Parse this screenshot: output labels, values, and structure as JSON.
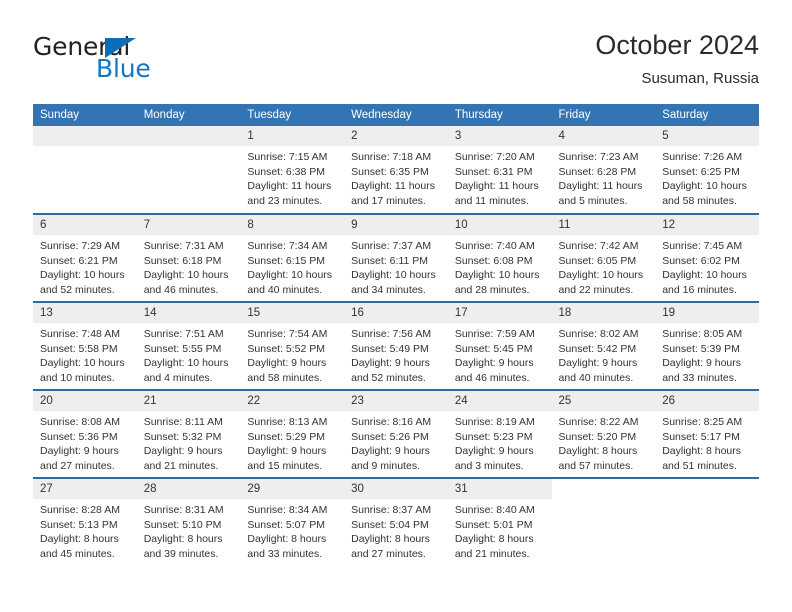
{
  "brand": {
    "name_part1": "General",
    "name_part2": "Blue",
    "triangle_color": "#0f6cb6",
    "blue_color": "#1277c4"
  },
  "header": {
    "title": "October 2024",
    "subtitle": "Susuman, Russia"
  },
  "theme": {
    "header_bg": "#3375b4",
    "week_divider": "#2e6da4",
    "daynum_bg": "#eeeeee",
    "text": "#333333"
  },
  "weekday_headers": [
    "Sunday",
    "Monday",
    "Tuesday",
    "Wednesday",
    "Thursday",
    "Friday",
    "Saturday"
  ],
  "weeks": [
    [
      {
        "day": "",
        "empty": true,
        "blank": false,
        "sunrise": "",
        "sunset": "",
        "daylight1": "",
        "daylight2": ""
      },
      {
        "day": "",
        "empty": true,
        "blank": false,
        "sunrise": "",
        "sunset": "",
        "daylight1": "",
        "daylight2": ""
      },
      {
        "day": "1",
        "sunrise": "Sunrise: 7:15 AM",
        "sunset": "Sunset: 6:38 PM",
        "daylight1": "Daylight: 11 hours",
        "daylight2": "and 23 minutes."
      },
      {
        "day": "2",
        "sunrise": "Sunrise: 7:18 AM",
        "sunset": "Sunset: 6:35 PM",
        "daylight1": "Daylight: 11 hours",
        "daylight2": "and 17 minutes."
      },
      {
        "day": "3",
        "sunrise": "Sunrise: 7:20 AM",
        "sunset": "Sunset: 6:31 PM",
        "daylight1": "Daylight: 11 hours",
        "daylight2": "and 11 minutes."
      },
      {
        "day": "4",
        "sunrise": "Sunrise: 7:23 AM",
        "sunset": "Sunset: 6:28 PM",
        "daylight1": "Daylight: 11 hours",
        "daylight2": "and 5 minutes."
      },
      {
        "day": "5",
        "sunrise": "Sunrise: 7:26 AM",
        "sunset": "Sunset: 6:25 PM",
        "daylight1": "Daylight: 10 hours",
        "daylight2": "and 58 minutes."
      }
    ],
    [
      {
        "day": "6",
        "sunrise": "Sunrise: 7:29 AM",
        "sunset": "Sunset: 6:21 PM",
        "daylight1": "Daylight: 10 hours",
        "daylight2": "and 52 minutes."
      },
      {
        "day": "7",
        "sunrise": "Sunrise: 7:31 AM",
        "sunset": "Sunset: 6:18 PM",
        "daylight1": "Daylight: 10 hours",
        "daylight2": "and 46 minutes."
      },
      {
        "day": "8",
        "sunrise": "Sunrise: 7:34 AM",
        "sunset": "Sunset: 6:15 PM",
        "daylight1": "Daylight: 10 hours",
        "daylight2": "and 40 minutes."
      },
      {
        "day": "9",
        "sunrise": "Sunrise: 7:37 AM",
        "sunset": "Sunset: 6:11 PM",
        "daylight1": "Daylight: 10 hours",
        "daylight2": "and 34 minutes."
      },
      {
        "day": "10",
        "sunrise": "Sunrise: 7:40 AM",
        "sunset": "Sunset: 6:08 PM",
        "daylight1": "Daylight: 10 hours",
        "daylight2": "and 28 minutes."
      },
      {
        "day": "11",
        "sunrise": "Sunrise: 7:42 AM",
        "sunset": "Sunset: 6:05 PM",
        "daylight1": "Daylight: 10 hours",
        "daylight2": "and 22 minutes."
      },
      {
        "day": "12",
        "sunrise": "Sunrise: 7:45 AM",
        "sunset": "Sunset: 6:02 PM",
        "daylight1": "Daylight: 10 hours",
        "daylight2": "and 16 minutes."
      }
    ],
    [
      {
        "day": "13",
        "sunrise": "Sunrise: 7:48 AM",
        "sunset": "Sunset: 5:58 PM",
        "daylight1": "Daylight: 10 hours",
        "daylight2": "and 10 minutes."
      },
      {
        "day": "14",
        "sunrise": "Sunrise: 7:51 AM",
        "sunset": "Sunset: 5:55 PM",
        "daylight1": "Daylight: 10 hours",
        "daylight2": "and 4 minutes."
      },
      {
        "day": "15",
        "sunrise": "Sunrise: 7:54 AM",
        "sunset": "Sunset: 5:52 PM",
        "daylight1": "Daylight: 9 hours",
        "daylight2": "and 58 minutes."
      },
      {
        "day": "16",
        "sunrise": "Sunrise: 7:56 AM",
        "sunset": "Sunset: 5:49 PM",
        "daylight1": "Daylight: 9 hours",
        "daylight2": "and 52 minutes."
      },
      {
        "day": "17",
        "sunrise": "Sunrise: 7:59 AM",
        "sunset": "Sunset: 5:45 PM",
        "daylight1": "Daylight: 9 hours",
        "daylight2": "and 46 minutes."
      },
      {
        "day": "18",
        "sunrise": "Sunrise: 8:02 AM",
        "sunset": "Sunset: 5:42 PM",
        "daylight1": "Daylight: 9 hours",
        "daylight2": "and 40 minutes."
      },
      {
        "day": "19",
        "sunrise": "Sunrise: 8:05 AM",
        "sunset": "Sunset: 5:39 PM",
        "daylight1": "Daylight: 9 hours",
        "daylight2": "and 33 minutes."
      }
    ],
    [
      {
        "day": "20",
        "sunrise": "Sunrise: 8:08 AM",
        "sunset": "Sunset: 5:36 PM",
        "daylight1": "Daylight: 9 hours",
        "daylight2": "and 27 minutes."
      },
      {
        "day": "21",
        "sunrise": "Sunrise: 8:11 AM",
        "sunset": "Sunset: 5:32 PM",
        "daylight1": "Daylight: 9 hours",
        "daylight2": "and 21 minutes."
      },
      {
        "day": "22",
        "sunrise": "Sunrise: 8:13 AM",
        "sunset": "Sunset: 5:29 PM",
        "daylight1": "Daylight: 9 hours",
        "daylight2": "and 15 minutes."
      },
      {
        "day": "23",
        "sunrise": "Sunrise: 8:16 AM",
        "sunset": "Sunset: 5:26 PM",
        "daylight1": "Daylight: 9 hours",
        "daylight2": "and 9 minutes."
      },
      {
        "day": "24",
        "sunrise": "Sunrise: 8:19 AM",
        "sunset": "Sunset: 5:23 PM",
        "daylight1": "Daylight: 9 hours",
        "daylight2": "and 3 minutes."
      },
      {
        "day": "25",
        "sunrise": "Sunrise: 8:22 AM",
        "sunset": "Sunset: 5:20 PM",
        "daylight1": "Daylight: 8 hours",
        "daylight2": "and 57 minutes."
      },
      {
        "day": "26",
        "sunrise": "Sunrise: 8:25 AM",
        "sunset": "Sunset: 5:17 PM",
        "daylight1": "Daylight: 8 hours",
        "daylight2": "and 51 minutes."
      }
    ],
    [
      {
        "day": "27",
        "sunrise": "Sunrise: 8:28 AM",
        "sunset": "Sunset: 5:13 PM",
        "daylight1": "Daylight: 8 hours",
        "daylight2": "and 45 minutes."
      },
      {
        "day": "28",
        "sunrise": "Sunrise: 8:31 AM",
        "sunset": "Sunset: 5:10 PM",
        "daylight1": "Daylight: 8 hours",
        "daylight2": "and 39 minutes."
      },
      {
        "day": "29",
        "sunrise": "Sunrise: 8:34 AM",
        "sunset": "Sunset: 5:07 PM",
        "daylight1": "Daylight: 8 hours",
        "daylight2": "and 33 minutes."
      },
      {
        "day": "30",
        "sunrise": "Sunrise: 8:37 AM",
        "sunset": "Sunset: 5:04 PM",
        "daylight1": "Daylight: 8 hours",
        "daylight2": "and 27 minutes."
      },
      {
        "day": "31",
        "sunrise": "Sunrise: 8:40 AM",
        "sunset": "Sunset: 5:01 PM",
        "daylight1": "Daylight: 8 hours",
        "daylight2": "and 21 minutes."
      },
      {
        "day": "",
        "empty": false,
        "blank": true,
        "sunrise": "",
        "sunset": "",
        "daylight1": "",
        "daylight2": ""
      },
      {
        "day": "",
        "empty": false,
        "blank": true,
        "sunrise": "",
        "sunset": "",
        "daylight1": "",
        "daylight2": ""
      }
    ]
  ]
}
